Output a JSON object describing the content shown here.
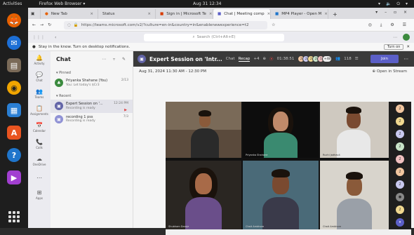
{
  "os": {
    "activities": "Activities",
    "app_name": "Firefox Web Browser ▾",
    "clock": "Aug 31  12:34",
    "system_icons": "▾ 🔈 ⏻ ▾"
  },
  "browser": {
    "tabs": [
      {
        "label": "New Tab"
      },
      {
        "label": "Status"
      },
      {
        "label": "Sign in | Microsoft Te"
      },
      {
        "label": "Chat | Meeting comp"
      },
      {
        "label": "MP4 Player - Open M"
      }
    ],
    "url": "https://teams.microsoft.com/v2/?culture=en-in&country=in&enablenewexperience=t2",
    "url_domain": "teams.microsoft.com"
  },
  "teams": {
    "search_placeholder": "Search (Ctrl+Alt+E)",
    "notification_text": "Stay in the know. Turn on desktop notifications.",
    "turn_on_label": "Turn on",
    "rail": [
      {
        "label": "Activity",
        "glyph": "🔔"
      },
      {
        "label": "Chat",
        "glyph": "💬"
      },
      {
        "label": "Teams",
        "glyph": "👥"
      },
      {
        "label": "Assignments",
        "glyph": "📋"
      },
      {
        "label": "Calendar",
        "glyph": "📅"
      },
      {
        "label": "Calls",
        "glyph": "📞"
      },
      {
        "label": "OneDrive",
        "glyph": "☁"
      },
      {
        "label": "",
        "glyph": "⋯"
      },
      {
        "label": "Apps",
        "glyph": "⊞"
      }
    ],
    "chat": {
      "title": "Chat",
      "pinned_label": "▾ Pinned",
      "recent_label": "▾ Recent",
      "pinned": [
        {
          "name": "Priyanka Shahane (You)",
          "sub": "You: Let today's $Cr3",
          "time": "2/13"
        }
      ],
      "recent": [
        {
          "name": "Expert Session on '...",
          "sub": "Recording is ready",
          "time": "12:24 PM"
        },
        {
          "name": "recording 1 pss",
          "sub": "Recording is ready",
          "time": "7/3"
        }
      ]
    },
    "meeting": {
      "title": "Expert Session on 'Intr...",
      "tab_chat": "Chat",
      "tab_recap": "Recap",
      "tab_more": "+4",
      "record_time": "01:38:51",
      "participants_more": "+48",
      "participant_count": "118",
      "join_label": "Join",
      "date_range": "Aug 31, 2024 11:30 AM - 12:30 PM",
      "open_stream": "Open in Stream",
      "tile_names": [
        "",
        "Priyanka Shahane",
        "Ruchi jadhav4",
        "Shubham Daraje",
        "Chait Ambhore",
        "Chait Ambhore"
      ]
    }
  },
  "colors": {
    "teams_purple": "#5b5fc7",
    "meeting_bar": "#3a3a3a",
    "record_red": "#e04545"
  }
}
